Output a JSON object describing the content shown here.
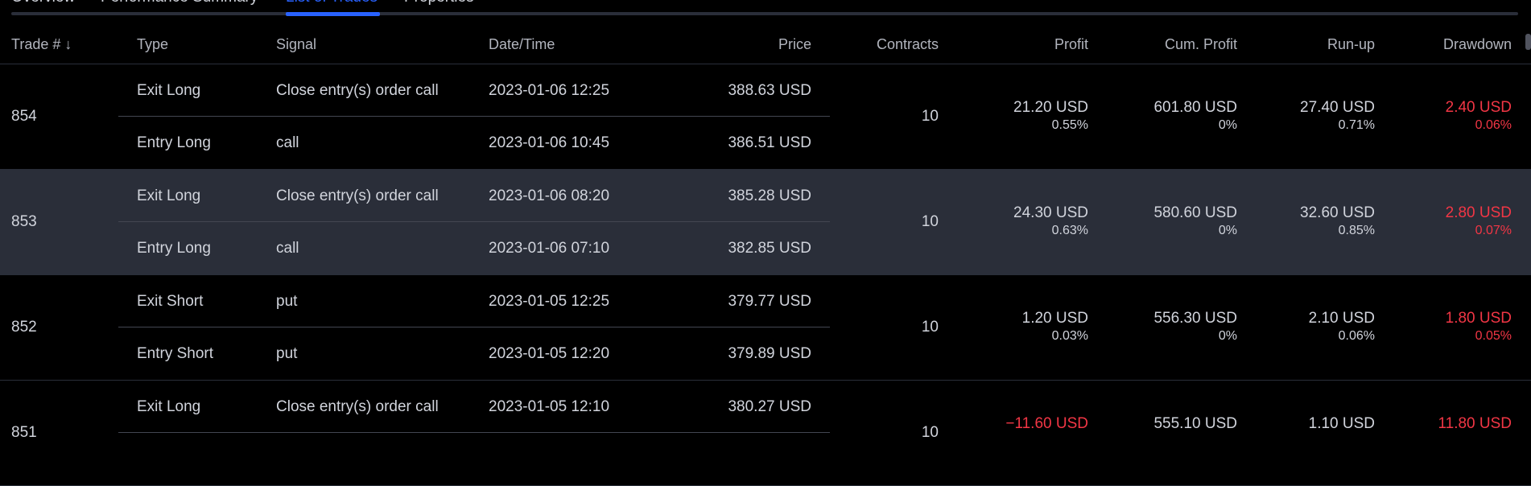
{
  "tabs": [
    {
      "label": "Overview",
      "active": false
    },
    {
      "label": "Performance Summary",
      "active": false
    },
    {
      "label": "List of Trades",
      "active": true
    },
    {
      "label": "Properties",
      "active": false
    }
  ],
  "columns": {
    "trade": "Trade #",
    "sort_icon": "↓",
    "type": "Type",
    "signal": "Signal",
    "datetime": "Date/Time",
    "price": "Price",
    "contracts": "Contracts",
    "profit": "Profit",
    "cum_profit": "Cum. Profit",
    "runup": "Run-up",
    "drawdown": "Drawdown"
  },
  "colors": {
    "background": "#000000",
    "text": "#d1d4dc",
    "accent": "#2962ff",
    "negative": "#f23645",
    "highlight_row": "#2a2e39"
  },
  "trades": [
    {
      "number": "854",
      "exit": {
        "type": "Exit Long",
        "signal": "Close entry(s) order call",
        "datetime": "2023-01-06 12:25",
        "price": "388.63 USD"
      },
      "entry": {
        "type": "Entry Long",
        "signal": "call",
        "datetime": "2023-01-06 10:45",
        "price": "386.51 USD"
      },
      "contracts": "10",
      "profit": "21.20 USD",
      "profit_pct": "0.55%",
      "cum_profit": "601.80 USD",
      "cum_profit_pct": "0%",
      "runup": "27.40 USD",
      "runup_pct": "0.71%",
      "drawdown": "2.40 USD",
      "drawdown_pct": "0.06%"
    },
    {
      "number": "853",
      "exit": {
        "type": "Exit Long",
        "signal": "Close entry(s) order call",
        "datetime": "2023-01-06 08:20",
        "price": "385.28 USD"
      },
      "entry": {
        "type": "Entry Long",
        "signal": "call",
        "datetime": "2023-01-06 07:10",
        "price": "382.85 USD"
      },
      "contracts": "10",
      "profit": "24.30 USD",
      "profit_pct": "0.63%",
      "cum_profit": "580.60 USD",
      "cum_profit_pct": "0%",
      "runup": "32.60 USD",
      "runup_pct": "0.85%",
      "drawdown": "2.80 USD",
      "drawdown_pct": "0.07%"
    },
    {
      "number": "852",
      "exit": {
        "type": "Exit Short",
        "signal": "put",
        "datetime": "2023-01-05 12:25",
        "price": "379.77 USD"
      },
      "entry": {
        "type": "Entry Short",
        "signal": "put",
        "datetime": "2023-01-05 12:20",
        "price": "379.89 USD"
      },
      "contracts": "10",
      "profit": "1.20 USD",
      "profit_pct": "0.03%",
      "cum_profit": "556.30 USD",
      "cum_profit_pct": "0%",
      "runup": "2.10 USD",
      "runup_pct": "0.06%",
      "drawdown": "1.80 USD",
      "drawdown_pct": "0.05%"
    },
    {
      "number": "851",
      "exit": {
        "type": "Exit Long",
        "signal": "Close entry(s) order call",
        "datetime": "2023-01-05 12:10",
        "price": "380.27 USD"
      },
      "entry": {
        "type": "",
        "signal": "",
        "datetime": "",
        "price": ""
      },
      "contracts": "10",
      "profit": "−11.60 USD",
      "profit_pct": "",
      "cum_profit": "555.10 USD",
      "cum_profit_pct": "",
      "runup": "1.10 USD",
      "runup_pct": "",
      "drawdown": "11.80 USD",
      "drawdown_pct": ""
    }
  ]
}
